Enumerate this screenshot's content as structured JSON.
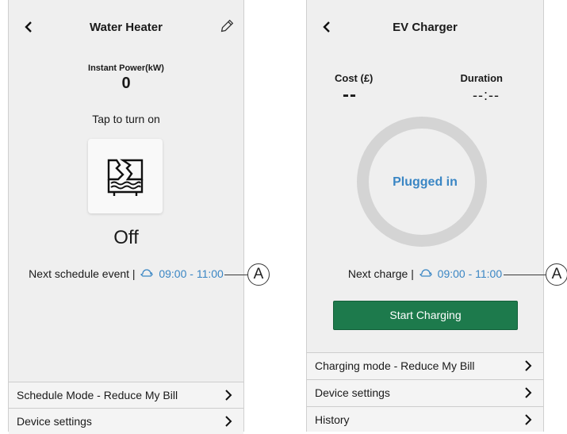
{
  "water_heater": {
    "title": "Water Heater",
    "power_label": "Instant Power(kW)",
    "power_value": "0",
    "tap_text": "Tap to turn on",
    "state": "Off",
    "schedule_prefix": "Next schedule event |",
    "schedule_time": "09:00 -  11:00",
    "rows": [
      {
        "label": "Schedule Mode - Reduce My Bill"
      },
      {
        "label": "Device settings"
      }
    ],
    "callout": "A"
  },
  "ev_charger": {
    "title": "EV Charger",
    "cost_label": "Cost (£)",
    "cost_value": "--",
    "duration_label": "Duration",
    "duration_value": "--:--",
    "status": "Plugged in",
    "next_prefix": "Next charge |",
    "next_time": "09:00 -  11:00",
    "button": "Start Charging",
    "rows": [
      {
        "label": "Charging mode - Reduce My Bill"
      },
      {
        "label": "Device settings"
      },
      {
        "label": "History"
      }
    ],
    "callout": "A"
  },
  "colors": {
    "accent_blue": "#3a86c4",
    "button_green": "#1d7a4c",
    "ring_gray": "#d4d4d4"
  },
  "icons": [
    "back-arrow-icon",
    "edit-pencil-icon",
    "water-heater-off-icon",
    "clock-icon",
    "chevron-right-icon"
  ]
}
